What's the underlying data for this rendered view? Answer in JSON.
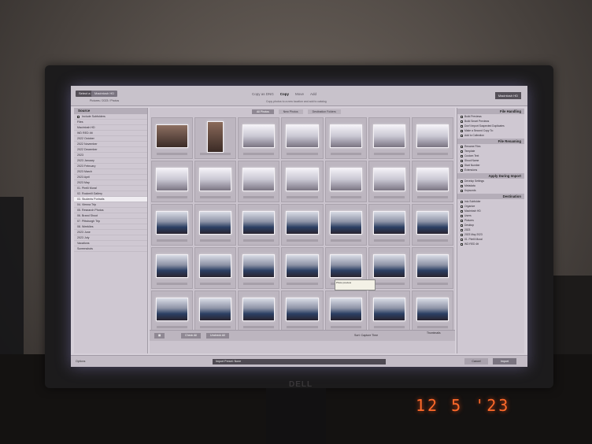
{
  "header": {
    "source_primary": "Select a source",
    "source_secondary": "Macintosh HD",
    "source_path": "Pictures / 2023 / Photos",
    "modes": [
      "Copy as DNG",
      "Copy",
      "Move",
      "Add"
    ],
    "active_mode": "Copy",
    "mode_subtitle": "Copy photos to a new location and add to catalog",
    "destination": "Macintosh HD"
  },
  "left_panel": {
    "title": "Source",
    "include_subfolders": "Include Subfolders",
    "items": [
      "Files",
      "Macintosh HD",
      "WD RED 4tt",
      "2022 October",
      "2022 November",
      "2022 December",
      "2023",
      "2023 January",
      "2023 February",
      "2023 March",
      "2023 April",
      "2023 May",
      "01. Pirelli Mural",
      "02. Rockmill Gallery",
      "03. Students Portraits",
      "04. Vienna Trip",
      "05. Research Photos",
      "06. Brand Shoot",
      "07. Pittsburgh Trip",
      "08. Weeklies",
      "2023 June",
      "2023 July",
      "Vacations",
      "Screenshots"
    ],
    "selected_index": 14
  },
  "center": {
    "tabs": [
      "All Photos",
      "New Photos",
      "Destination Folders"
    ],
    "active_tab": 0,
    "tooltip": "Photo preview",
    "check_all": "Check All",
    "uncheck_all": "Uncheck All",
    "sort_label": "Sort:",
    "sort_value": "Capture Time",
    "thumbnails_label": "Thumbnails"
  },
  "right_panel": {
    "sections": [
      {
        "title": "File Handling",
        "rows": [
          "Build Previews",
          "Build Smart Previews",
          "Don't Import Suspected Duplicates",
          "Make a Second Copy To:",
          "Add to Collection"
        ]
      },
      {
        "title": "File Renaming",
        "rows": [
          "Rename Files",
          "Template",
          "Custom Text",
          "Shoot Name",
          "Start Number",
          "Extensions"
        ]
      },
      {
        "title": "Apply During Import",
        "rows": [
          "Develop Settings",
          "Metadata",
          "Keywords"
        ]
      },
      {
        "title": "Destination",
        "rows": [
          "Into Subfolder",
          "Organize",
          "Macintosh HD",
          "Users",
          "Pictures",
          "Desktop",
          "2023",
          "2023 May 2023",
          "01. Pirelli Mural",
          "WD RED 4tt"
        ]
      }
    ]
  },
  "footer": {
    "collapse_label": "Options",
    "preset_label": "Import Preset:",
    "preset_value": "None",
    "cancel_label": "Cancel",
    "import_label": "Import"
  },
  "photo_date": "12  5  '23",
  "monitor_logo": "DELL"
}
